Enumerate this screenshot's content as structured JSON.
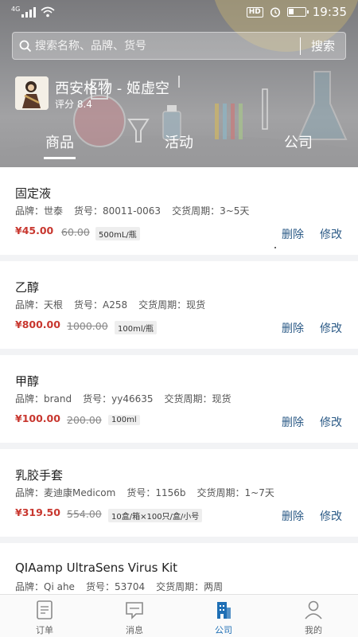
{
  "status_bar": {
    "network": "4G",
    "hd": "HD",
    "time": "19:35"
  },
  "search": {
    "placeholder": "搜索名称、品牌、货号",
    "button": "搜索"
  },
  "shop": {
    "name": "西安格物 - 姬虚空",
    "rating": "评分 8.4"
  },
  "tabs": [
    {
      "label": "商品",
      "active": true
    },
    {
      "label": "活动",
      "active": false
    },
    {
      "label": "公司",
      "active": false
    }
  ],
  "products": [
    {
      "name": "固定液",
      "brand": "品牌：世泰",
      "sku": "货号：80011-0063",
      "delivery": "交货周期：3~5天",
      "price": "¥45.00",
      "old_price": "60.00",
      "spec": "500mL/瓶",
      "delete": "删除",
      "edit": "修改"
    },
    {
      "name": "乙醇",
      "brand": "品牌：天根",
      "sku": "货号：A258",
      "delivery": "交货周期：现货",
      "price": "¥800.00",
      "old_price": "1000.00",
      "spec": "100ml/瓶",
      "delete": "删除",
      "edit": "修改"
    },
    {
      "name": "甲醇",
      "brand": "品牌：brand",
      "sku": "货号：yy46635",
      "delivery": "交货周期：现货",
      "price": "¥100.00",
      "old_price": "200.00",
      "spec": "100ml",
      "delete": "删除",
      "edit": "修改"
    },
    {
      "name": "乳胶手套",
      "brand": "品牌：麦迪康Medicom",
      "sku": "货号：1156b",
      "delivery": "交货周期：1~7天",
      "price": "¥319.50",
      "old_price": "554.00",
      "spec": "10盒/箱×100只/盒/小号",
      "delete": "删除",
      "edit": "修改"
    },
    {
      "name": "QIAamp UltraSens Virus Kit",
      "brand": "品牌：Qi ahe",
      "sku": "货号：53704",
      "delivery": "交货周期：两周",
      "price": "",
      "old_price": "",
      "spec": "",
      "delete": "",
      "edit": ""
    }
  ],
  "bottom_nav": [
    {
      "label": "订单",
      "icon": "order-icon",
      "active": false
    },
    {
      "label": "消息",
      "icon": "message-icon",
      "active": false
    },
    {
      "label": "公司",
      "icon": "company-icon",
      "active": true
    },
    {
      "label": "我的",
      "icon": "profile-icon",
      "active": false
    }
  ],
  "colors": {
    "price_red": "#c8372f",
    "action_blue": "#2b5a86",
    "nav_active": "#1f6fb5"
  }
}
